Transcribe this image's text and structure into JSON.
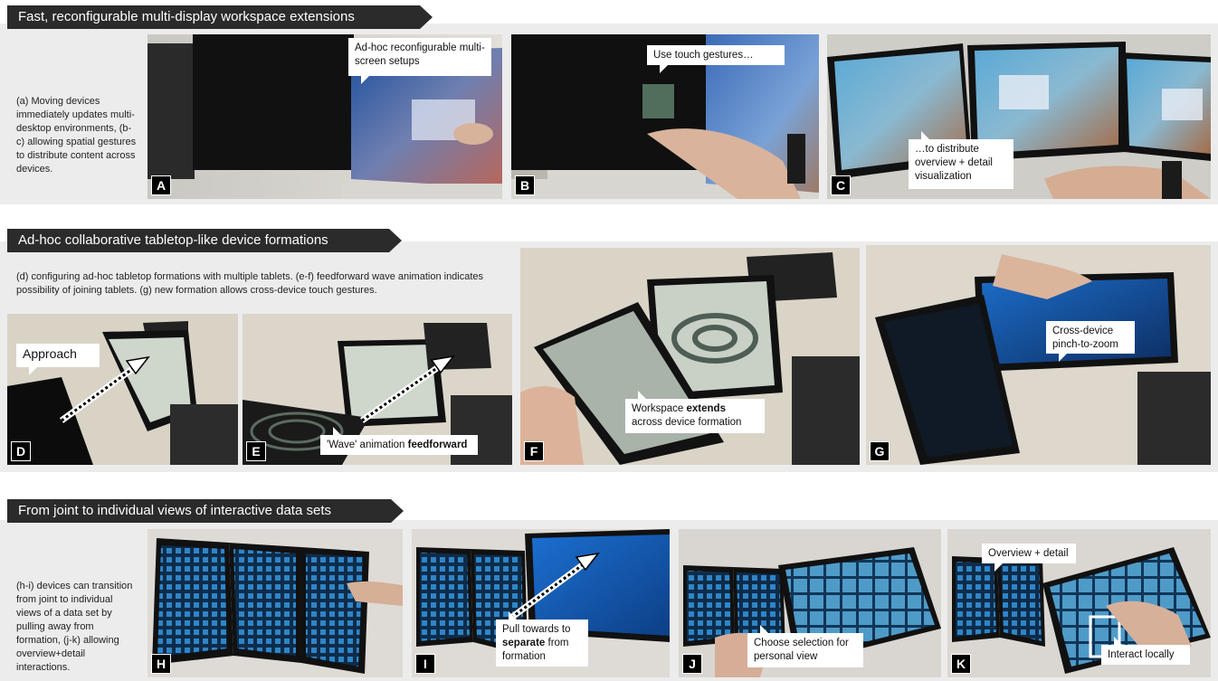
{
  "section1": {
    "title": "Fast, reconfigurable multi-display workspace extensions",
    "description": "(a) Moving devices immediately updates multi-desktop environments, (b-c) allowing spatial gestures to distribute content across devices.",
    "panels": [
      {
        "label": "A",
        "callout": "Ad-hoc reconfigurable multi-screen setups"
      },
      {
        "label": "B",
        "callout": "Use touch gestures…"
      },
      {
        "label": "C",
        "callout": "…to distribute overview + detail visualization"
      }
    ]
  },
  "section2": {
    "title": "Ad-hoc collaborative tabletop-like device formations",
    "description": "(d) configuring ad-hoc tabletop formations with multiple tablets. (e-f) feedforward wave animation indicates possibility of joining tablets. (g) new formation allows cross-device touch gestures.",
    "panels": [
      {
        "label": "D",
        "callout": "Approach"
      },
      {
        "label": "E",
        "callout_pre": "'Wave' animation ",
        "callout_bold": "feedforward"
      },
      {
        "label": "F",
        "callout_pre": "Workspace ",
        "callout_bold": "extends",
        "callout_post": "across device formation"
      },
      {
        "label": "G",
        "callout": "Cross-device pinch-to-zoom"
      }
    ]
  },
  "section3": {
    "title": "From joint to individual views of interactive data sets",
    "description": "(h-i) devices can transition from joint to individual views of a data set by pulling away from formation, (j-k) allowing overview+detail interactions.",
    "panels": [
      {
        "label": "H"
      },
      {
        "label": "I",
        "callout_pre": "Pull towards to ",
        "callout_bold": "separate",
        "callout_post": " from formation"
      },
      {
        "label": "J",
        "callout": "Choose selection for personal view"
      },
      {
        "label": "K",
        "callout": "Overview + detail",
        "callout2": "Interact locally"
      }
    ]
  }
}
